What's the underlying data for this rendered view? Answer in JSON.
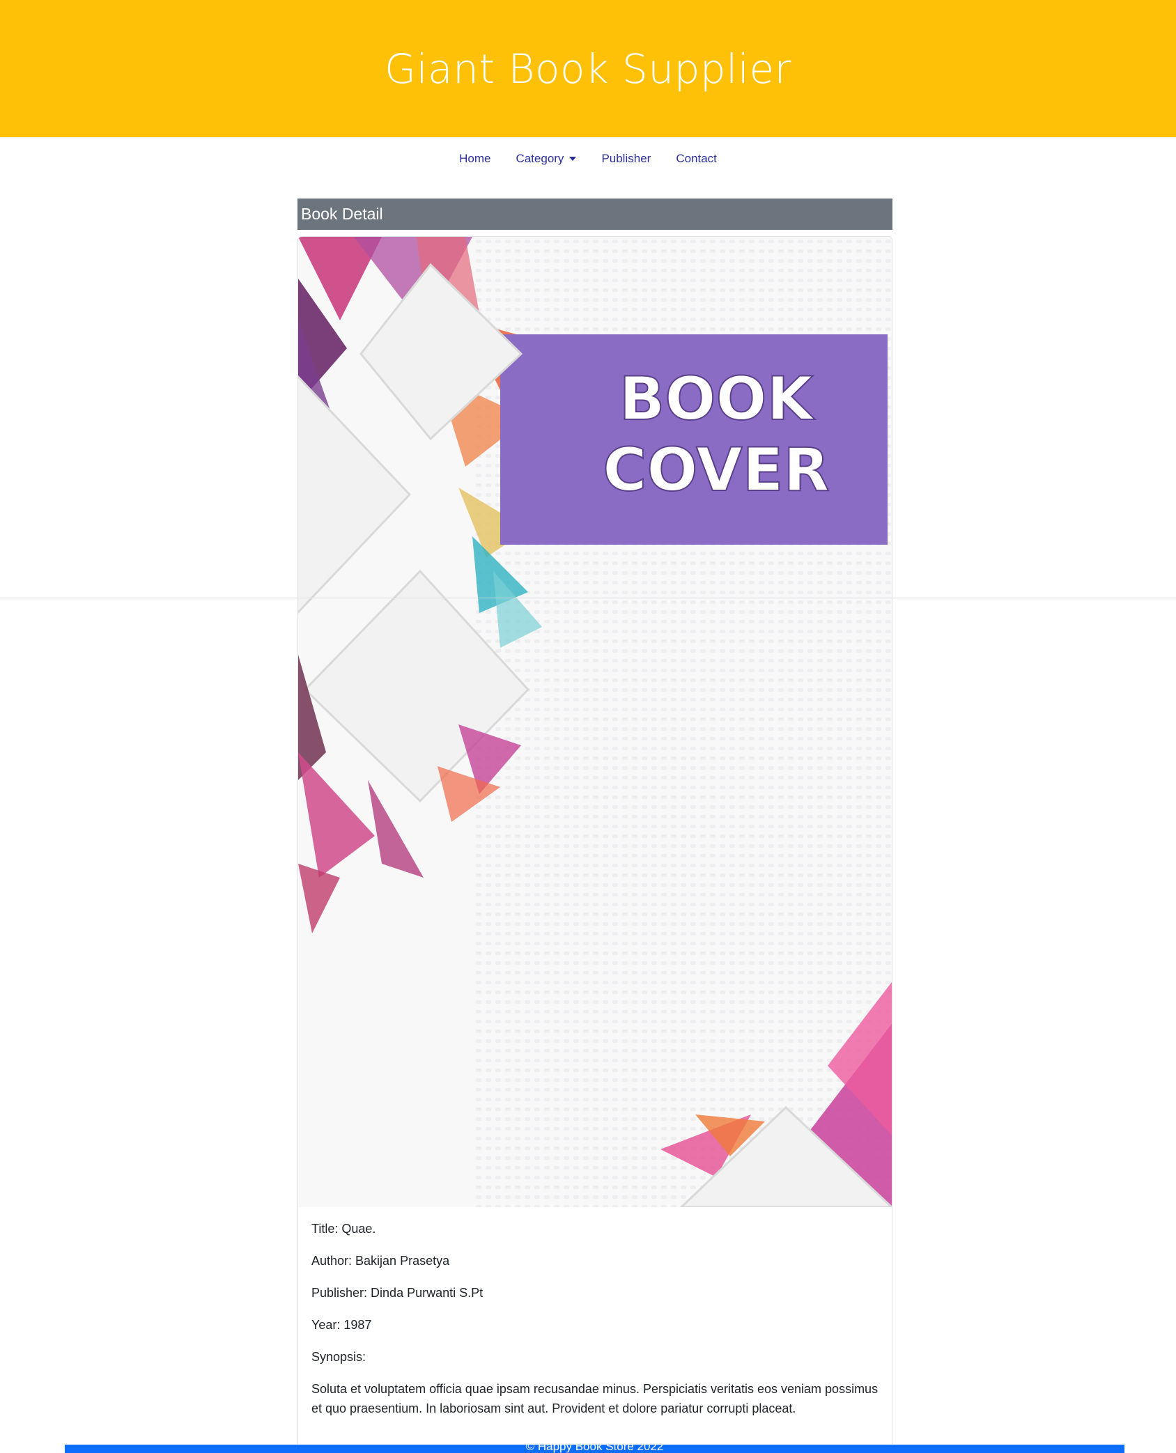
{
  "header": {
    "title": "Giant Book Supplier"
  },
  "nav": {
    "home": "Home",
    "category": "Category",
    "publisher": "Publisher",
    "contact": "Contact"
  },
  "section": {
    "title": "Book Detail"
  },
  "cover": {
    "line1": "BOOK",
    "line2": "COVER",
    "accent": "#8a6cc4"
  },
  "book": {
    "title": "Title: Quae.",
    "author": "Author: Bakijan Prasetya",
    "publisher": "Publisher: Dinda Purwanti S.Pt",
    "year": "Year: 1987",
    "synopsis_label": "Synopsis:",
    "synopsis": "Soluta et voluptatem officia quae ipsam recusandae minus. Perspiciatis veritatis eos veniam possimus et quo praesentium. In laboriosam sint aut. Provident et dolore pariatur corrupti placeat."
  },
  "footer": {
    "text": "© Happy Book Store 2022"
  },
  "colors": {
    "hero": "#ffc107",
    "section": "#6c757d",
    "footer": "#0d6efd",
    "link": "#2b2f9a"
  }
}
